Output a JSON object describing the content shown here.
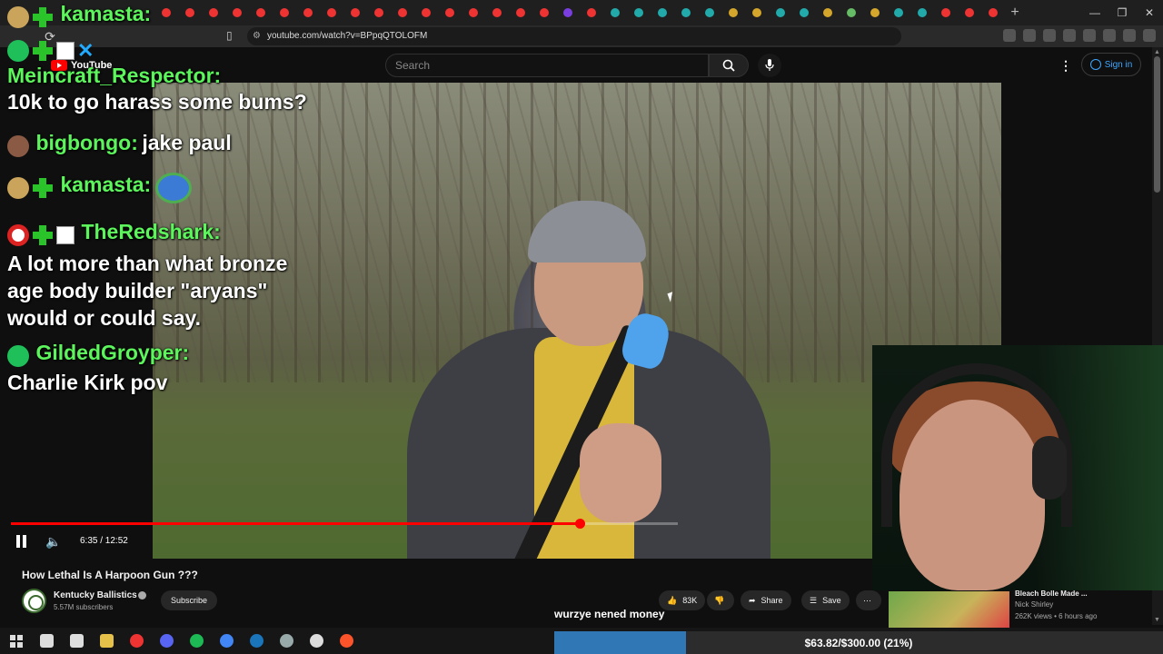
{
  "browser": {
    "url": "youtube.com/watch?v=BPpqQTOLOFM",
    "tab_colors": [
      "#e33",
      "#e33",
      "#e33",
      "#e33",
      "#e33",
      "#e33",
      "#e33",
      "#e33",
      "#e33",
      "#e33",
      "#e33",
      "#e33",
      "#e33",
      "#e33",
      "#e33",
      "#e33",
      "#e33",
      "#7a3ee0",
      "#e33",
      "#2aa",
      "#2aa",
      "#2aa",
      "#2aa",
      "#2aa",
      "#d4a72c",
      "#d4a72c",
      "#2aa",
      "#2aa",
      "#d4a72c",
      "#6b6",
      "#d4a72c",
      "#2aa",
      "#2aa",
      "#e33",
      "#e33",
      "#e33"
    ]
  },
  "youtube": {
    "logo_text": "YouTube",
    "search_placeholder": "Search",
    "sign_in_label": "Sign in"
  },
  "chat": {
    "messages": [
      {
        "user": "kamasta:",
        "text": ""
      },
      {
        "user": "Meincraft_Respector:",
        "text": "10k to go harass some bums?"
      },
      {
        "user": "bigbongo:",
        "text": "jake paul"
      },
      {
        "user": "kamasta:",
        "text": ""
      },
      {
        "user": "TheRedshark:",
        "text": "A lot more than what bronze age body builder \"aryans\" would or could say."
      },
      {
        "user": "GildedGroyper:",
        "text": "Charlie Kirk pov"
      }
    ]
  },
  "player": {
    "time": "6:35 / 12:52",
    "progress_fraction": 0.8527
  },
  "video_info": {
    "title": "How Lethal Is A Harpoon Gun ???",
    "channel": "Kentucky Ballistics",
    "subscribers": "5.57M subscribers",
    "subscribe_label": "Subscribe",
    "likes": "83K",
    "share_label": "Share",
    "save_label": "Save"
  },
  "recommendation": {
    "title": "Bleach Bolle Made ...",
    "channel": "Nick Shirley",
    "meta": "262K views • 6 hours ago"
  },
  "stream_overlay": {
    "subtitle": "wurzye nened money",
    "goal_text": "$63.82/$300.00 (21%)",
    "goal_fraction": 0.21
  },
  "taskbar": {
    "icon_colors": [
      "#ddd",
      "#ddd",
      "#ddd",
      "#e6c14a",
      "#e33",
      "#5865f2",
      "#1db954",
      "#4285f4",
      "#1b75bb",
      "#9aa",
      "#ddd",
      "#fb542b"
    ]
  }
}
